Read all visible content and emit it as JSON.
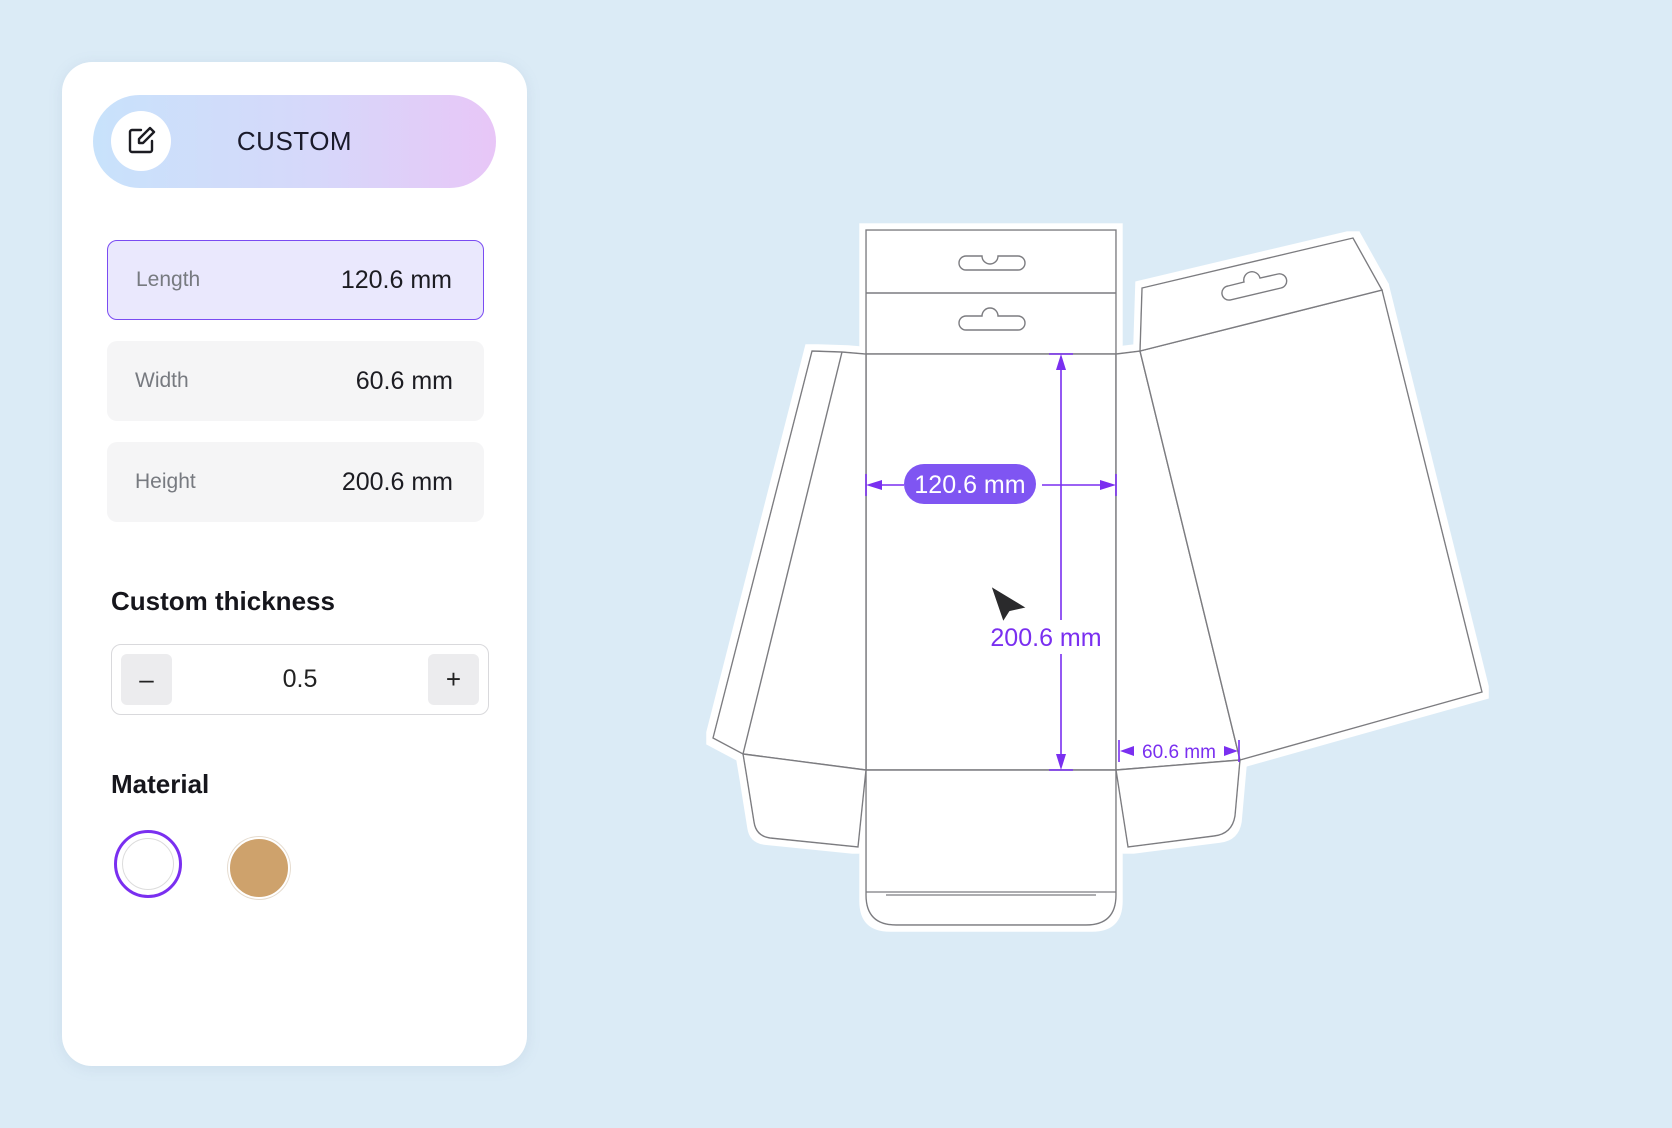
{
  "sidebar": {
    "mode_button": {
      "label": "CUSTOM",
      "icon": "edit-icon"
    },
    "dimensions": [
      {
        "label": "Length",
        "value": "120.6 mm",
        "active": true
      },
      {
        "label": "Width",
        "value": "60.6 mm",
        "active": false
      },
      {
        "label": "Height",
        "value": "200.6 mm",
        "active": false
      }
    ],
    "thickness": {
      "title": "Custom thickness",
      "value": "0.5",
      "decrement_label": "–",
      "increment_label": "+"
    },
    "material": {
      "title": "Material",
      "options": [
        {
          "name": "white",
          "color": "#ffffff",
          "selected": true
        },
        {
          "name": "kraft",
          "color": "#cea26c",
          "selected": false
        }
      ]
    }
  },
  "canvas": {
    "length_label": "120.6 mm",
    "height_label": "200.6 mm",
    "width_label": "60.6 mm",
    "accent_color": "#7a2ff0",
    "cursor_icon": "pointer-arrow-icon"
  }
}
